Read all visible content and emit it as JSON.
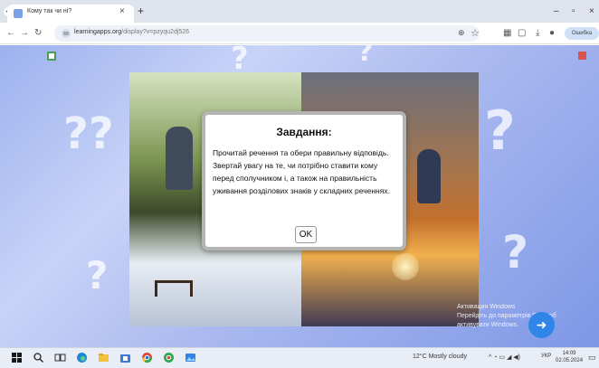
{
  "browser": {
    "tab_title": "Кому так чи ні?",
    "url_host": "learningapps.org",
    "url_path": "/display?v=pzyqu2dj526",
    "error_button": "Ошибка"
  },
  "dialog": {
    "title": "Завдання:",
    "body": "Прочитай речення та обери правильну відповідь. Звертай увагу на те, чи потрібно ставити кому перед сполучником і, а також на правильність уживання розділових знаків у складних реченнях.",
    "ok_label": "OK"
  },
  "watermark": {
    "line1": "Активация Windows",
    "line2": "Перейдіть до параметрів ПК, щоб",
    "line3": "активувати Windows."
  },
  "taskbar": {
    "weather": "12°C  Mostly cloudy",
    "language": "УКР",
    "time": "14:09",
    "date": "02.05.2024"
  },
  "colors": {
    "accent": "#2f86e6",
    "page_background": "#9cb1ee"
  }
}
